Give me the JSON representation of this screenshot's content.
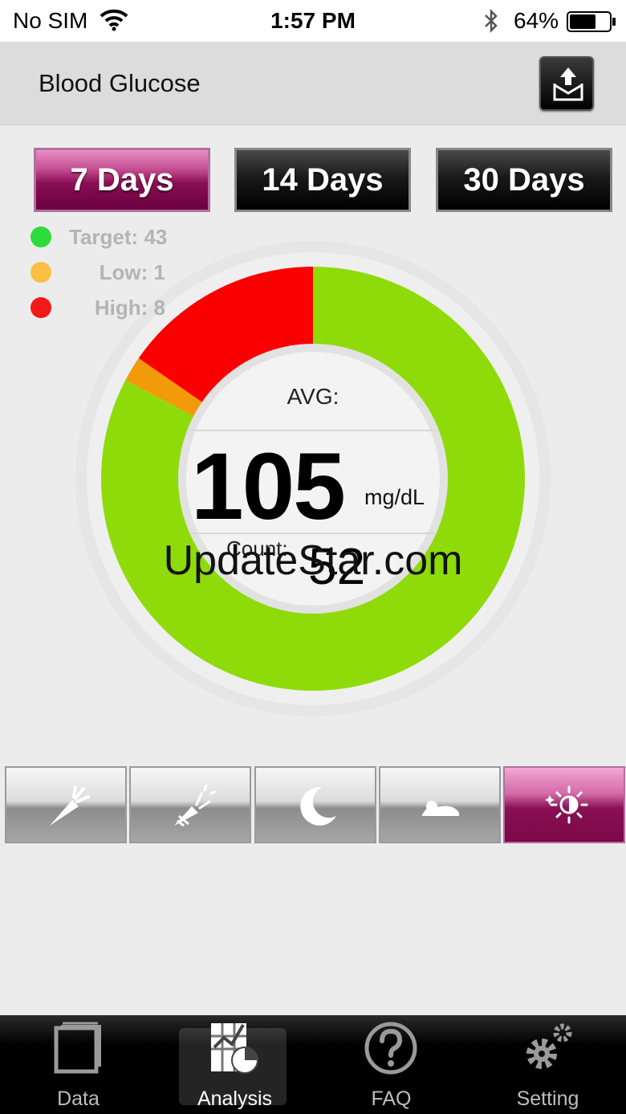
{
  "status_bar": {
    "carrier": "No SIM",
    "time": "1:57 PM",
    "battery_percent": "64%"
  },
  "header": {
    "title": "Blood Glucose",
    "share_icon": "share-tray-icon"
  },
  "range_buttons": [
    {
      "label": "7 Days",
      "active": true
    },
    {
      "label": "14 Days",
      "active": false
    },
    {
      "label": "30 Days",
      "active": false
    }
  ],
  "legend": [
    {
      "label": "Target:",
      "value": "43",
      "color": "#2bdc3c"
    },
    {
      "label": "Low:",
      "value": "1",
      "color": "#fbbf44"
    },
    {
      "label": "High:",
      "value": "8",
      "color": "#f41818"
    }
  ],
  "chart_data": {
    "type": "pie",
    "variant": "donut",
    "start_angle_deg": 0,
    "slices": [
      {
        "category": "Target",
        "value": 43,
        "color": "#8fdb0a"
      },
      {
        "category": "Low",
        "value": 1,
        "color": "#f29a0a"
      },
      {
        "category": "High",
        "value": 8,
        "color": "#fb0000"
      }
    ]
  },
  "summary": {
    "avg_label": "AVG:",
    "avg_value": "105",
    "unit": "mg/dL",
    "count_label": "Count:",
    "count_value": "52"
  },
  "watermark": "UpdateStar.com",
  "meal_tabs": [
    {
      "icon": "carrot-icon",
      "active": false
    },
    {
      "icon": "carrot-bite-icon",
      "active": false
    },
    {
      "icon": "moon-icon",
      "active": false
    },
    {
      "icon": "bed-sleep-icon",
      "active": false
    },
    {
      "icon": "sun-all-day-icon",
      "active": true
    }
  ],
  "tabbar": [
    {
      "label": "Data",
      "icon": "notepad-icon",
      "selected": false
    },
    {
      "label": "Analysis",
      "icon": "chart-analysis-icon",
      "selected": true
    },
    {
      "label": "FAQ",
      "icon": "question-icon",
      "selected": false
    },
    {
      "label": "Setting",
      "icon": "gears-icon",
      "selected": false
    }
  ]
}
